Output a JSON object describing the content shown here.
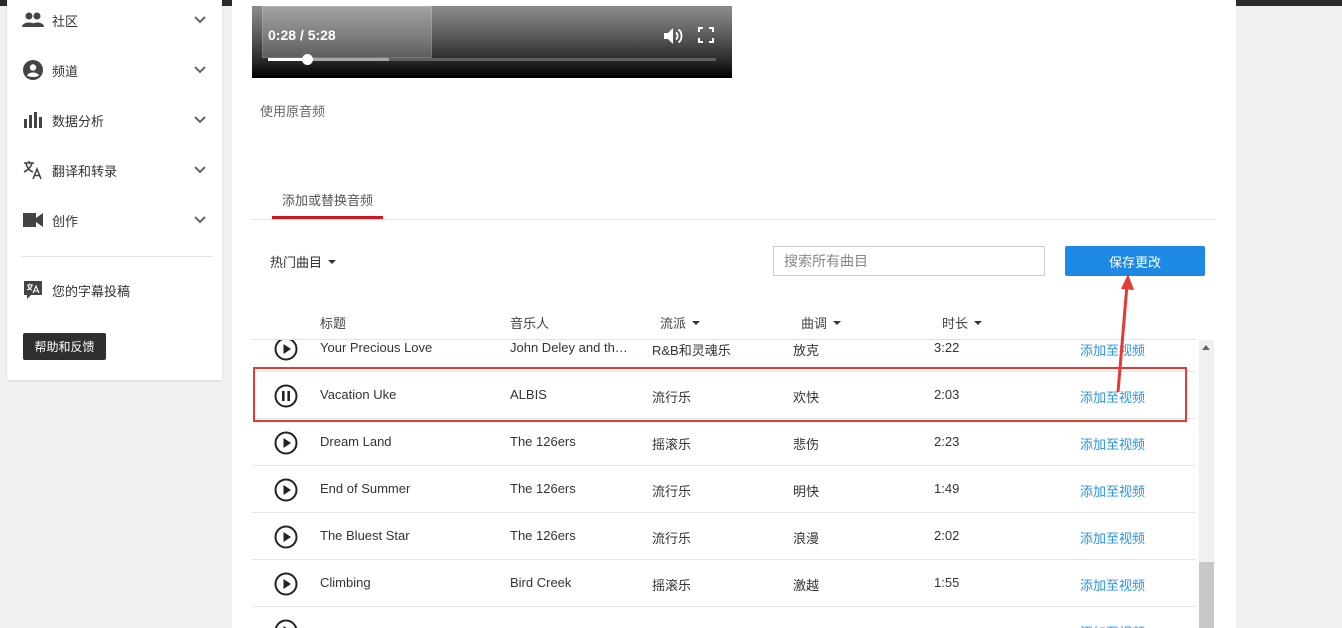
{
  "sidebar": {
    "items": [
      {
        "label": "社区",
        "icon": "people-icon"
      },
      {
        "label": "频道",
        "icon": "account-circle-icon"
      },
      {
        "label": "数据分析",
        "icon": "bar-chart-icon"
      },
      {
        "label": "翻译和转录",
        "icon": "translate-icon"
      },
      {
        "label": "创作",
        "icon": "video-camera-icon"
      }
    ],
    "subtitle_item": {
      "label": "您的字幕投稿",
      "icon": "subtitles-translate-icon"
    },
    "help_button": "帮助和反馈"
  },
  "player": {
    "time_display": "0:28 / 5:28",
    "progress": 0.088,
    "buffered": 0.27
  },
  "audio_note": "使用原音频",
  "tabs": [
    {
      "label": "添加或替换音频",
      "active": true
    }
  ],
  "filter": {
    "label": "热门曲目"
  },
  "search": {
    "placeholder": "搜索所有曲目"
  },
  "save_button": "保存更改",
  "table": {
    "columns": {
      "title": "标题",
      "artist": "音乐人",
      "genre": "流派",
      "mood": "曲调",
      "duration": "时长"
    },
    "rows": [
      {
        "title": "Your Precious Love",
        "artist": "John Deley and the ...",
        "genre": "R&B和灵魂乐",
        "mood": "放克",
        "duration": "3:22",
        "action": "添加至视频",
        "state": "play"
      },
      {
        "title": "Vacation Uke",
        "artist": "ALBIS",
        "genre": "流行乐",
        "mood": "欢快",
        "duration": "2:03",
        "action": "添加至视频",
        "state": "pause"
      },
      {
        "title": "Dream Land",
        "artist": "The 126ers",
        "genre": "摇滚乐",
        "mood": "悲伤",
        "duration": "2:23",
        "action": "添加至视频",
        "state": "play"
      },
      {
        "title": "End of Summer",
        "artist": "The 126ers",
        "genre": "流行乐",
        "mood": "明快",
        "duration": "1:49",
        "action": "添加至视频",
        "state": "play"
      },
      {
        "title": "The Bluest Star",
        "artist": "The 126ers",
        "genre": "流行乐",
        "mood": "浪漫",
        "duration": "2:02",
        "action": "添加至视频",
        "state": "play"
      },
      {
        "title": "Climbing",
        "artist": "Bird Creek",
        "genre": "摇滚乐",
        "mood": "激越",
        "duration": "1:55",
        "action": "添加至视频",
        "state": "play"
      },
      {
        "title": "",
        "artist": "",
        "genre": "",
        "mood": "",
        "duration": "",
        "action": "添加至视频",
        "state": "play"
      }
    ]
  },
  "colors": {
    "accent_blue": "#1e88e5",
    "link_blue": "#2793e6",
    "tab_red": "#cc181e",
    "annotation_red": "#e53935"
  }
}
